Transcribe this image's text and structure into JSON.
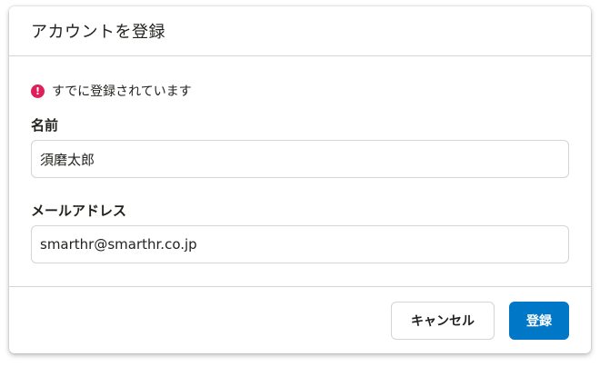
{
  "dialog": {
    "title": "アカウントを登録",
    "error": {
      "icon": "exclamation-circle-icon",
      "message": "すでに登録されています",
      "color": "#e01e5a"
    },
    "fields": {
      "name": {
        "label": "名前",
        "value": "須磨太郎"
      },
      "email": {
        "label": "メールアドレス",
        "value": "smarthr@smarthr.co.jp"
      }
    },
    "actions": {
      "cancel_label": "キャンセル",
      "submit_label": "登録"
    },
    "colors": {
      "primary": "#0077c7",
      "text": "#23221e",
      "border": "#d6d3d0"
    }
  }
}
